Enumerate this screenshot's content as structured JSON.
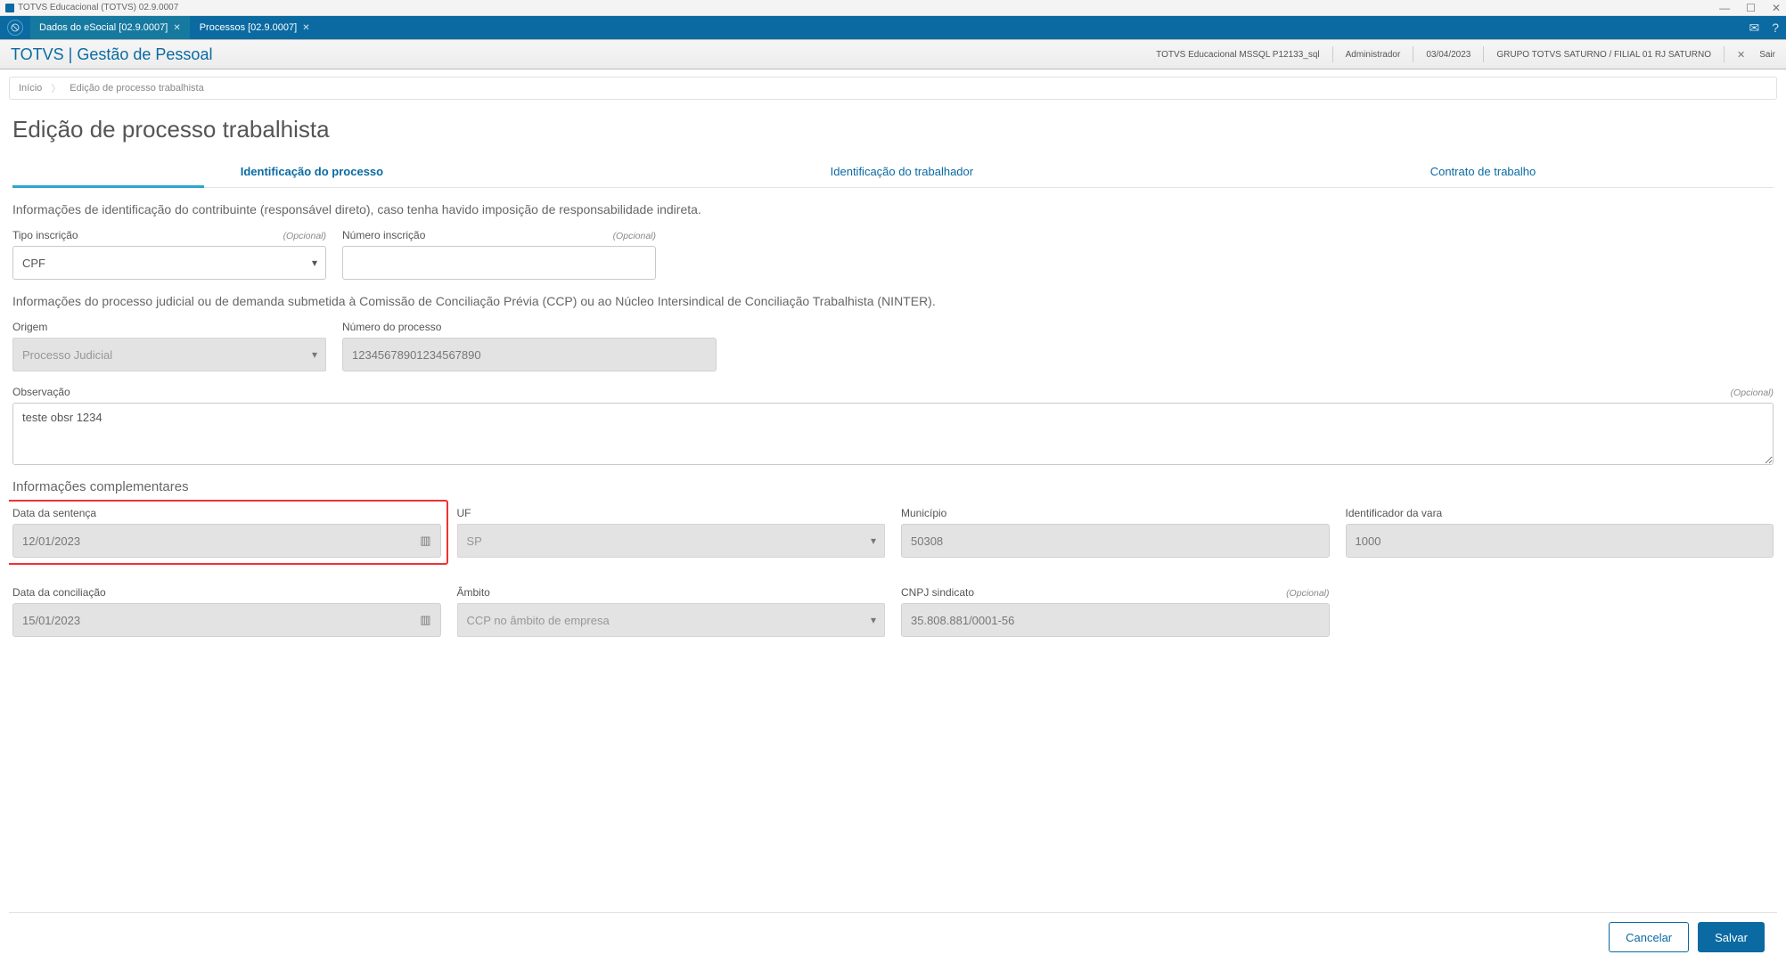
{
  "window": {
    "title": "TOTVS Educacional (TOTVS) 02.9.0007"
  },
  "tabs": {
    "items": [
      {
        "label": "Dados do eSocial [02.9.0007]"
      },
      {
        "label": "Processos [02.9.0007]"
      }
    ]
  },
  "ribbon": {
    "brand": "TOTVS | Gestão de Pessoal",
    "db": "TOTVS Educacional MSSQL P12133_sql",
    "user": "Administrador",
    "date": "03/04/2023",
    "company": "GRUPO TOTVS SATURNO / FILIAL 01 RJ SATURNO",
    "sair": "Sair"
  },
  "breadcrumb": {
    "home": "Início",
    "current": "Edição de processo trabalhista"
  },
  "page_title": "Edição de processo trabalhista",
  "inner_tabs": {
    "t1": "Identificação do processo",
    "t2": "Identificação do trabalhador",
    "t3": "Contrato de trabalho"
  },
  "section1": {
    "desc": "Informações de identificação do contribuinte (responsável direto), caso tenha havido imposição de responsabilidade indireta.",
    "tipo_inscricao": {
      "label": "Tipo inscrição",
      "optional": "(Opcional)",
      "value": "CPF"
    },
    "numero_inscricao": {
      "label": "Número inscrição",
      "optional": "(Opcional)",
      "value": ""
    }
  },
  "section2": {
    "desc": "Informações do processo judicial ou de demanda submetida à Comissão de Conciliação Prévia (CCP) ou ao Núcleo Intersindical de Conciliação Trabalhista (NINTER).",
    "origem": {
      "label": "Origem",
      "value": "Processo Judicial"
    },
    "numero_processo": {
      "label": "Número do processo",
      "value": "12345678901234567890"
    },
    "observacao": {
      "label": "Observação",
      "optional": "(Opcional)",
      "value": "teste obsr 1234"
    }
  },
  "section3": {
    "title": "Informações complementares",
    "data_sentenca": {
      "label": "Data da sentença",
      "value": "12/01/2023"
    },
    "uf": {
      "label": "UF",
      "value": "SP"
    },
    "municipio": {
      "label": "Município",
      "value": "50308"
    },
    "identificador_vara": {
      "label": "Identificador da vara",
      "value": "1000"
    },
    "data_conciliacao": {
      "label": "Data da conciliação",
      "value": "15/01/2023"
    },
    "ambito": {
      "label": "Âmbito",
      "value": "CCP no âmbito de empresa"
    },
    "cnpj_sindicato": {
      "label": "CNPJ sindicato",
      "optional": "(Opcional)",
      "value": "35.808.881/0001-56"
    }
  },
  "footer": {
    "cancel": "Cancelar",
    "save": "Salvar"
  }
}
